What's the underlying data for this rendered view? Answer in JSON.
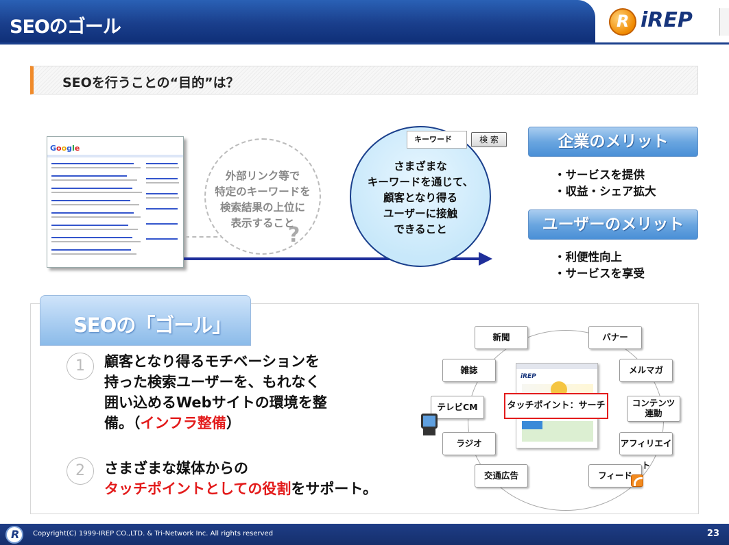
{
  "header": {
    "title": "SEOのゴール",
    "logo_text": "iREP"
  },
  "question": "SEOを行うことの“目的”は？",
  "left_circle_text": [
    "外部リンク等で",
    "特定のキーワードを",
    "検索結果の上位に",
    "表示すること"
  ],
  "question_mark": "?",
  "search": {
    "keyword": "キーワード",
    "button": "検 索"
  },
  "center_circle_text": [
    "さまざまな",
    "キーワードを通じて、",
    "顧客となり得る",
    "ユーザーに接触",
    "できること"
  ],
  "merits": [
    {
      "heading": "企業のメリット",
      "items": [
        "・サービスを提供",
        "・収益・シェア拡大"
      ]
    },
    {
      "heading": "ユーザーのメリット",
      "items": [
        "・利便性向上",
        "・サービスを享受"
      ]
    }
  ],
  "goal": {
    "title": "SEOの「ゴール」",
    "point1": {
      "number": "1",
      "lines": [
        "顧客となり得るモチベーションを",
        "持った検索ユーザーを、もれなく",
        "囲い込めるWebサイトの環境を整"
      ],
      "last_prefix": "備。（",
      "last_red": "インフラ整備",
      "last_suffix": "）"
    },
    "point2": {
      "number": "2",
      "line1": "さまざまな媒体からの",
      "red": "タッチポイントとしての役割",
      "suffix": "をサポート。"
    }
  },
  "diagram": {
    "center": "タッチポイント：サーチ",
    "nodes": [
      "新聞",
      "バナー",
      "雑誌",
      "メルマガ",
      "テレビCM",
      "コンテンツ 連動",
      "ラジオ",
      "アフィリエイト",
      "交通広告",
      "フィード"
    ]
  },
  "footer": {
    "copyright": "Copyright(C) 1999-IREP CO.,LTD. & Tri-Network Inc. All rights reserved",
    "page": "23"
  }
}
